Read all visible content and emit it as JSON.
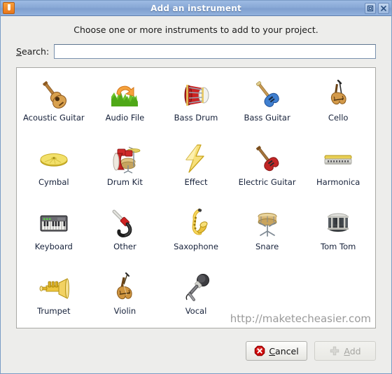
{
  "window": {
    "title": "Add an instrument",
    "app_icon": "lmms-j-icon",
    "controls": [
      {
        "name": "maximize-button",
        "icon": "maximize-icon"
      },
      {
        "name": "close-button",
        "icon": "close-icon"
      }
    ]
  },
  "dialog": {
    "prompt": "Choose one or more instruments to add to your project.",
    "search": {
      "label_prefix": "S",
      "label_rest": "earch:",
      "value": "",
      "placeholder": ""
    },
    "watermark": "http://maketecheasier.com"
  },
  "instruments": [
    {
      "label": "Acoustic Guitar",
      "icon": "acoustic-guitar-icon"
    },
    {
      "label": "Audio File",
      "icon": "audio-file-icon"
    },
    {
      "label": "Bass Drum",
      "icon": "bass-drum-icon"
    },
    {
      "label": "Bass Guitar",
      "icon": "bass-guitar-icon"
    },
    {
      "label": "Cello",
      "icon": "cello-icon"
    },
    {
      "label": "Cymbal",
      "icon": "cymbal-icon"
    },
    {
      "label": "Drum Kit",
      "icon": "drum-kit-icon"
    },
    {
      "label": "Effect",
      "icon": "effect-icon"
    },
    {
      "label": "Electric Guitar",
      "icon": "electric-guitar-icon"
    },
    {
      "label": "Harmonica",
      "icon": "harmonica-icon"
    },
    {
      "label": "Keyboard",
      "icon": "keyboard-icon"
    },
    {
      "label": "Other",
      "icon": "other-cable-icon"
    },
    {
      "label": "Saxophone",
      "icon": "saxophone-icon"
    },
    {
      "label": "Snare",
      "icon": "snare-icon"
    },
    {
      "label": "Tom Tom",
      "icon": "tom-tom-icon"
    },
    {
      "label": "Trumpet",
      "icon": "trumpet-icon"
    },
    {
      "label": "Violin",
      "icon": "violin-icon"
    },
    {
      "label": "Vocal",
      "icon": "vocal-microphone-icon"
    }
  ],
  "footer": {
    "cancel": {
      "prefix": "",
      "accel": "C",
      "rest": "ancel",
      "icon": "cancel-stop-icon",
      "enabled": true
    },
    "add": {
      "prefix": "",
      "accel": "A",
      "rest": "dd",
      "icon": "plus-icon",
      "enabled": false
    }
  },
  "colors": {
    "titlebar": "#89a9d6",
    "dialog_bg": "#ededeb",
    "panel_bg": "#ffffff",
    "label_text": "#16213a",
    "watermark": "#9a9a9a",
    "cancel_red": "#cc0000"
  }
}
